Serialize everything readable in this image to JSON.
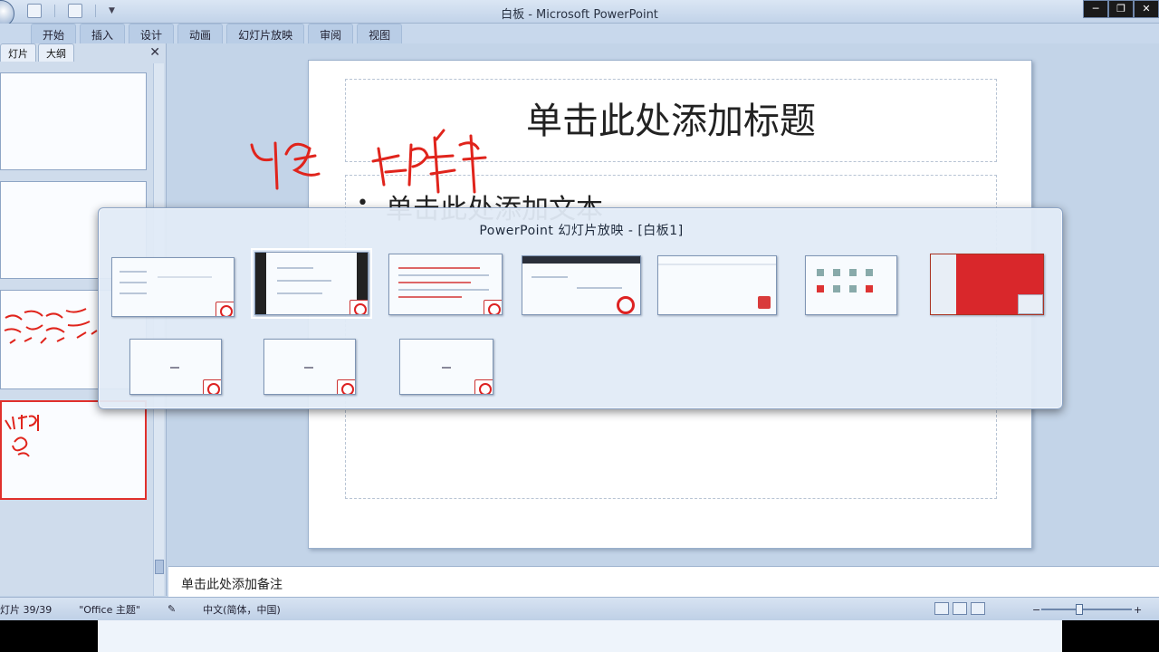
{
  "window": {
    "title": "白板 - Microsoft PowerPoint",
    "min_label": "─",
    "max_label": "❐",
    "close_label": "✕"
  },
  "ribbon": {
    "tabs": [
      "开始",
      "插入",
      "设计",
      "动画",
      "幻灯片放映",
      "审阅",
      "视图"
    ]
  },
  "slides_panel": {
    "tab_slides": "灯片",
    "tab_outline": "大纲",
    "close_label": "✕"
  },
  "slide": {
    "title_placeholder": "单击此处添加标题",
    "body_placeholder": "单击此处添加文本",
    "bullet": "•"
  },
  "notes": {
    "placeholder": "单击此处添加备注"
  },
  "status_bar": {
    "slide_count": "灯片 39/39",
    "theme": "\"Office 主题\"",
    "language": "中文(简体，中国)"
  },
  "switcher": {
    "title": "PowerPoint 幻灯片放映 - [白板1]",
    "windows_count": 10,
    "active_index": 1
  },
  "colors": {
    "accent_red": "#d9272b",
    "chrome_blue": "#c3d4e8",
    "ink_red": "#e0241c"
  }
}
